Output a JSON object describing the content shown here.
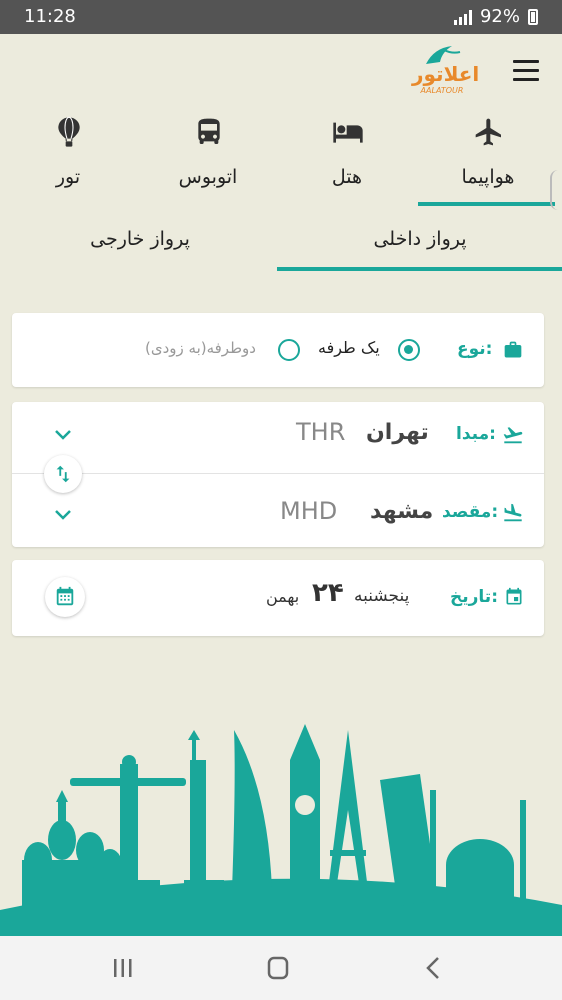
{
  "status": {
    "time": "11:28",
    "battery": "92%"
  },
  "logo": {
    "text": "اعلاتور",
    "sub": "AALATOUR"
  },
  "tabs": [
    {
      "label": "هواپیما",
      "icon": "airplane-icon",
      "active": true
    },
    {
      "label": "هتل",
      "icon": "bed-icon",
      "active": false
    },
    {
      "label": "اتوبوس",
      "icon": "bus-icon",
      "active": false
    },
    {
      "label": "تور",
      "icon": "hot-air-balloon-icon",
      "active": false
    }
  ],
  "subtabs": [
    {
      "label": "پرواز داخلی",
      "active": true
    },
    {
      "label": "پرواز خارجی",
      "active": false
    }
  ],
  "trip_type": {
    "label": "نوع:",
    "one_way": "یک طرفه",
    "round_trip": "دوطرفه(به زودی)",
    "selected": "one_way"
  },
  "origin": {
    "label": "مبدا:",
    "city": "تهران",
    "code": "THR"
  },
  "destination": {
    "label": "مقصد:",
    "city": "مشهد",
    "code": "MHD"
  },
  "date": {
    "label": "تاریخ:",
    "weekday": "پنجشنبه",
    "day": "۲۴",
    "month": "بهمن"
  },
  "colors": {
    "accent": "#1aa79a",
    "brand": "#e8892b",
    "background": "#ecebdd"
  }
}
